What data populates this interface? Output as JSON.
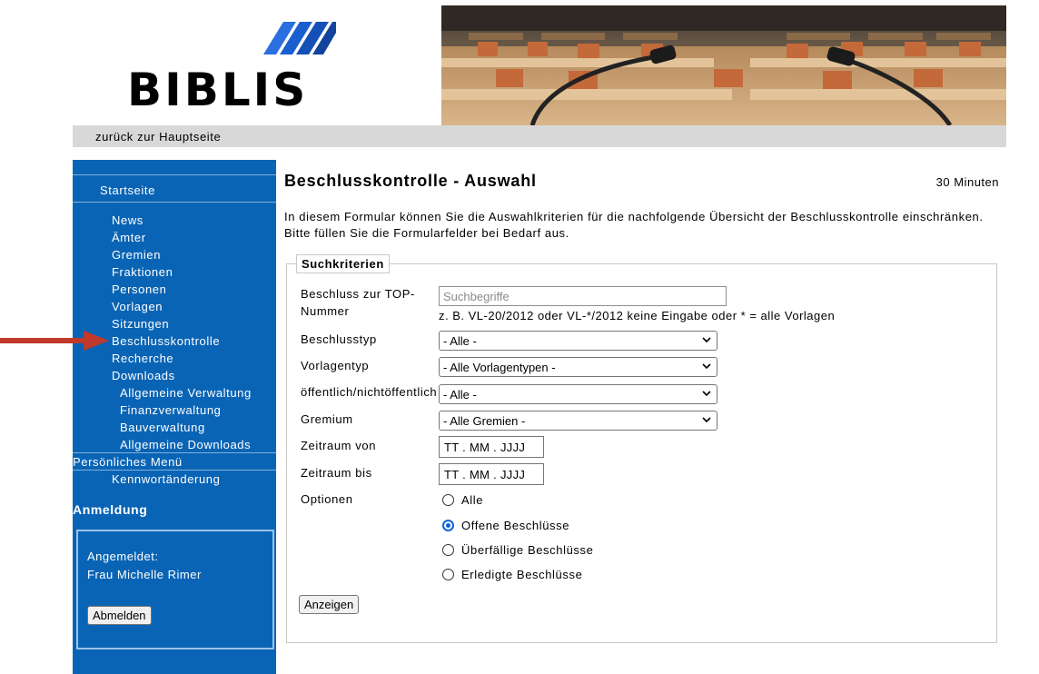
{
  "header": {
    "logo_text": "BIBLIS",
    "back_link": "zurück zur Hauptseite"
  },
  "sidebar": {
    "home": "Startseite",
    "items": [
      "News",
      "Ämter",
      "Gremien",
      "Fraktionen",
      "Personen",
      "Vorlagen",
      "Sitzungen",
      "Beschlusskontrolle",
      "Recherche",
      "Downloads"
    ],
    "downloads_sub": [
      "Allgemeine Verwaltung",
      "Finanzverwaltung",
      "Bauverwaltung",
      "Allgemeine Downloads"
    ],
    "personal_menu": "Persönliches Menü",
    "password_change": "Kennwortänderung",
    "login_heading": "Anmeldung",
    "logged_in_label": "Angemeldet:",
    "user_name": "Frau Michelle Rimer",
    "logout_button": "Abmelden"
  },
  "main": {
    "title": "Beschlusskontrolle - Auswahl",
    "timer": "30 Minuten",
    "intro": "In diesem Formular können Sie die Auswahlkriterien für die nachfolgende Übersicht der Beschlusskontrolle einschränken. Bitte füllen Sie die Formularfelder bei Bedarf aus.",
    "legend": "Suchkriterien",
    "form": {
      "top_label_1": "Beschluss zur TOP-",
      "top_label_2": "Nummer",
      "top_placeholder": "Suchbegriffe",
      "top_hint": "z. B. VL-20/2012 oder VL-*/2012 keine Eingabe oder * = alle Vorlagen",
      "type_label": "Beschlusstyp",
      "type_value": "- Alle -",
      "template_label": "Vorlagentyp",
      "template_value": "- Alle Vorlagentypen -",
      "public_label": "öffentlich/nichtöffentlich",
      "public_value": "- Alle -",
      "committee_label": "Gremium",
      "committee_value": "- Alle Gremien -",
      "from_label": "Zeitraum von",
      "from_value": "TT . MM . JJJJ",
      "to_label": "Zeitraum bis",
      "to_value": "TT . MM . JJJJ",
      "options_label": "Optionen",
      "options": [
        "Alle",
        "Offene Beschlüsse",
        "Überfällige Beschlüsse",
        "Erledigte Beschlüsse"
      ],
      "selected_option": "Offene Beschlüsse",
      "submit": "Anzeigen"
    }
  },
  "colors": {
    "sidebar_bg": "#0a64b5",
    "navbar_bg": "#d8d8d8",
    "logo_accent": "#1a5fd0",
    "arrow": "#c0392b"
  }
}
